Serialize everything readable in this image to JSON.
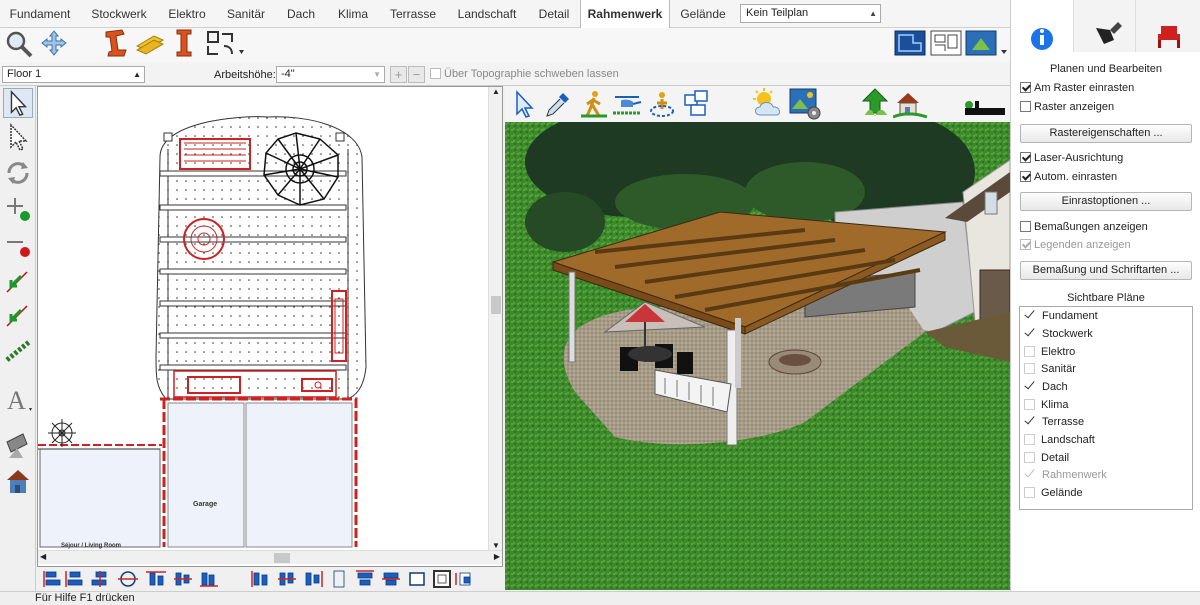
{
  "tabs": [
    {
      "label": "Fundament",
      "active": false
    },
    {
      "label": "Stockwerk",
      "active": false
    },
    {
      "label": "Elektro",
      "active": false
    },
    {
      "label": "Sanitär",
      "active": false
    },
    {
      "label": "Dach",
      "active": false
    },
    {
      "label": "Klima",
      "active": false
    },
    {
      "label": "Terrasse",
      "active": false
    },
    {
      "label": "Landschaft",
      "active": false
    },
    {
      "label": "Detail",
      "active": false
    },
    {
      "label": "Rahmenwerk",
      "active": true
    },
    {
      "label": "Gelände",
      "active": false
    }
  ],
  "plan_select": {
    "value": "Kein Teilplan"
  },
  "options": {
    "floor": "Floor 1",
    "height_label": "Arbeitshöhe:",
    "height_value": "-4\"",
    "topography_label": "Über Topographie schweben lassen",
    "topography_checked": false
  },
  "plan": {
    "garage_label": "Garage",
    "living_label": "Séjour / Living Room"
  },
  "status": {
    "text": "Für Hilfe F1 drücken"
  },
  "right_panel": {
    "tabs": [
      {
        "icon": "info-icon",
        "active": true
      },
      {
        "icon": "pen-nib-icon",
        "active": false
      },
      {
        "icon": "chair-icon",
        "active": false
      }
    ],
    "section_title": "Planen und Bearbeiten",
    "snap_grid": {
      "label": "Am Raster einrasten",
      "checked": true
    },
    "show_grid": {
      "label": "Raster anzeigen",
      "checked": false
    },
    "grid_props_button": "Rastereigenschaften ...",
    "laser": {
      "label": "Laser-Ausrichtung",
      "checked": true
    },
    "auto_snap": {
      "label": "Autom. einrasten",
      "checked": true
    },
    "snap_options_button": "Einrastoptionen ...",
    "show_dims": {
      "label": "Bemaßungen anzeigen",
      "checked": false
    },
    "show_legends": {
      "label": "Legenden anzeigen",
      "checked": true,
      "disabled": true
    },
    "dims_fonts_button": "Bemaßung und Schriftarten ...",
    "visible_plans_title": "Sichtbare Pläne",
    "visible_plans": [
      {
        "label": "Fundament",
        "checked": true,
        "disabled": false
      },
      {
        "label": "Stockwerk",
        "checked": true,
        "disabled": false
      },
      {
        "label": "Elektro",
        "checked": false,
        "disabled": false
      },
      {
        "label": "Sanitär",
        "checked": false,
        "disabled": false
      },
      {
        "label": "Dach",
        "checked": true,
        "disabled": false
      },
      {
        "label": "Klima",
        "checked": false,
        "disabled": false
      },
      {
        "label": "Terrasse",
        "checked": true,
        "disabled": false
      },
      {
        "label": "Landschaft",
        "checked": false,
        "disabled": false
      },
      {
        "label": "Detail",
        "checked": false,
        "disabled": false
      },
      {
        "label": "Rahmenwerk",
        "checked": true,
        "disabled": true
      },
      {
        "label": "Gelände",
        "checked": false,
        "disabled": false
      }
    ]
  },
  "colors": {
    "accent_blue": "#1a73e8",
    "wall_red": "#cc2222",
    "lawn_green": "#3d8a2c",
    "wood_brown": "#8a5a22"
  }
}
